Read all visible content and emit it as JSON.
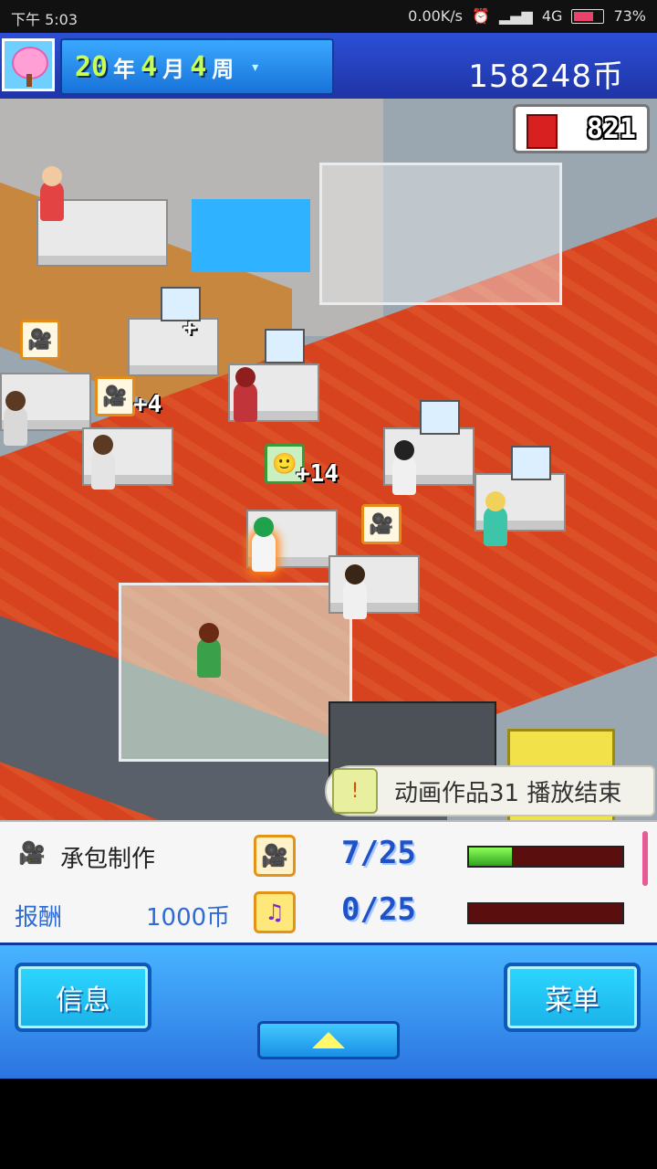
{
  "status_bar": {
    "time": "下午 5:03",
    "speed": "0.00K/s",
    "network": "4G",
    "battery": "73%",
    "battery_level": 0.73
  },
  "header": {
    "year": "20",
    "year_unit": "年",
    "month": "4",
    "month_unit": "月",
    "week": "4",
    "week_unit": "周",
    "money": "158248币"
  },
  "hud": {
    "counter": "821"
  },
  "world": {
    "popups": [
      {
        "text": "+4"
      },
      {
        "text": "+14"
      },
      {
        "text": "+"
      }
    ]
  },
  "notice": {
    "text": "动画作品31 播放结束"
  },
  "panel": {
    "job_title": "承包制作",
    "reward_label": "报酬",
    "reward_value": "1000币",
    "film_progress": "7/25",
    "film_fraction": 0.28,
    "music_progress": "0/25",
    "music_fraction": 0
  },
  "bottom": {
    "info_button": "信息",
    "menu_button": "菜单"
  },
  "icons": [
    "film-camera-icon",
    "music-note-icon",
    "sakura-tree-icon",
    "ticket-counter-icon",
    "up-arrow-icon"
  ]
}
